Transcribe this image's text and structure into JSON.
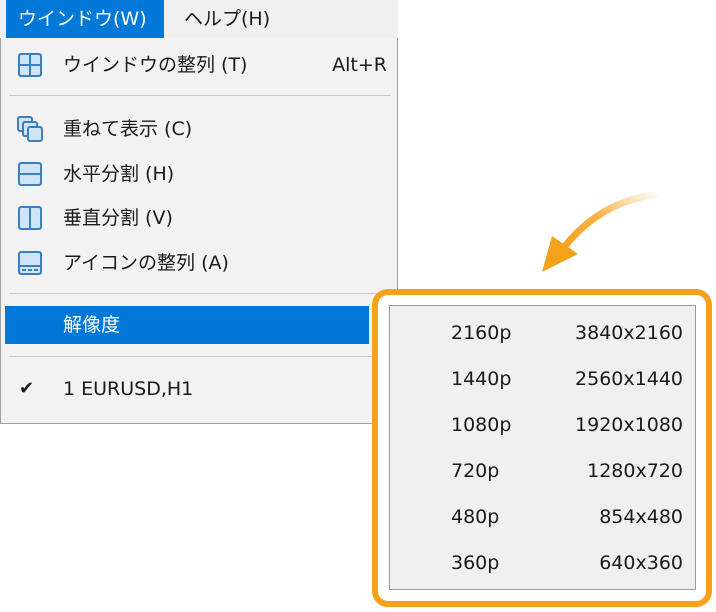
{
  "menubar": {
    "items": [
      {
        "label": "ウインドウ(W)",
        "active": true
      },
      {
        "label": "ヘルプ(H)",
        "active": false
      }
    ]
  },
  "dropdown": {
    "arrange": {
      "label": "ウインドウの整列 (T)",
      "shortcut": "Alt+R",
      "icon": "window-grid-icon"
    },
    "cascade": {
      "label": "重ねて表示 (C)",
      "icon": "cascade-windows-icon"
    },
    "tile_horizontal": {
      "label": "水平分割 (H)",
      "icon": "split-horizontal-icon"
    },
    "tile_vertical": {
      "label": "垂直分割 (V)",
      "icon": "split-vertical-icon"
    },
    "arrange_icons": {
      "label": "アイコンの整列 (A)",
      "icon": "arrange-icons-icon"
    },
    "resolution": {
      "label": "解像度",
      "highlighted": true
    },
    "window_item": {
      "check": "✔",
      "label": "1 EURUSD,H1"
    }
  },
  "resolution_submenu": {
    "items": [
      {
        "name": "2160p",
        "size": "3840x2160"
      },
      {
        "name": "1440p",
        "size": "2560x1440"
      },
      {
        "name": "1080p",
        "size": "1920x1080"
      },
      {
        "name": "720p",
        "size": "1280x720"
      },
      {
        "name": "480p",
        "size": "854x480"
      },
      {
        "name": "360p",
        "size": "640x360"
      }
    ]
  },
  "colors": {
    "highlight": "#0078d7",
    "callout_border": "#f5a11c",
    "icon_stroke": "#3a7fc1",
    "icon_fill": "#cfe4f7"
  }
}
